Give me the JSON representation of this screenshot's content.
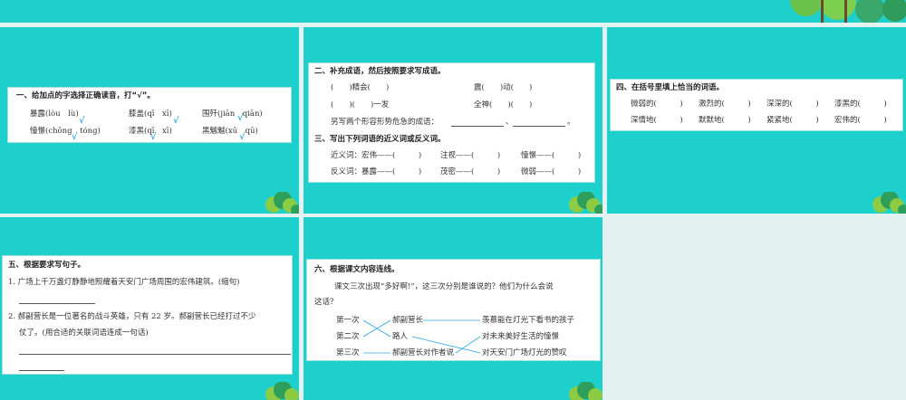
{
  "colors": {
    "teal": "#1ed0cc",
    "check": "#2aa8e0",
    "line": "#2aa8e0"
  },
  "q1": {
    "title": "一、给加点的字选择正确读音，打“√”。",
    "items": [
      "暴露(lòu　lù)",
      "膝盖(qī　xī)",
      "围歼(jiān　qiān)",
      "憧憬(chōng　tóng)",
      "漆黑(qī　xī)",
      "黑魆魆(xū　qū)"
    ],
    "check": "√"
  },
  "q2": {
    "title": "二、补充成语，然后按照要求写成语。",
    "items": [
      "(　　)精会(　　)",
      "震(　　)动(　　)",
      "(　　)(　　)一发",
      "全神(　　)(　　)"
    ],
    "extra": "另写两个形容形势危急的成语：",
    "sep": "、",
    "end": "。"
  },
  "q3": {
    "title": "三、写出下列词语的近义词或反义词。",
    "rows": [
      [
        "近义词：宏伟——(　　　)",
        "注视——(　　　)",
        "憧憬——(　　　)"
      ],
      [
        "反义词：暴露——(　　　)",
        "茂密——(　　　)",
        "微弱——(　　　)"
      ]
    ]
  },
  "q4": {
    "title": "四、在括号里填上恰当的词语。",
    "rows": [
      [
        "微弱的(　　　)",
        "激烈的(　　　)",
        "深深的(　　　)",
        "漆黑的(　　　)"
      ],
      [
        "深情地(　　　)",
        "默默地(　　　)",
        "紧紧地(　　　)",
        "宏伟的(　　　)"
      ]
    ]
  },
  "q5": {
    "title": "五、根据要求写句子。",
    "s1": "1. 广场上千万盏灯静静地照耀着天安门广场周围的宏伟建筑。(缩句)",
    "s2a": "2. 郝副营长是一位著名的战斗英雄，只有 22 岁。郝副营长已经打过不少",
    "s2b": "仗了。(用合适的关联词语连成一句话)"
  },
  "q6": {
    "title": "六、根据课文内容连线。",
    "p1": "课文三次出现“多好啊!”，这三次分别是谁说的？他们为什么会说",
    "p2": "这话？",
    "left": [
      "第一次",
      "第二次",
      "第三次"
    ],
    "mid": [
      "郝副营长",
      "路人",
      "郝副营长对作者说"
    ],
    "right": [
      "羡慕能在灯光下看书的孩子",
      "对未来美好生活的憧憬",
      "对天安门广场灯光的赞叹"
    ]
  }
}
